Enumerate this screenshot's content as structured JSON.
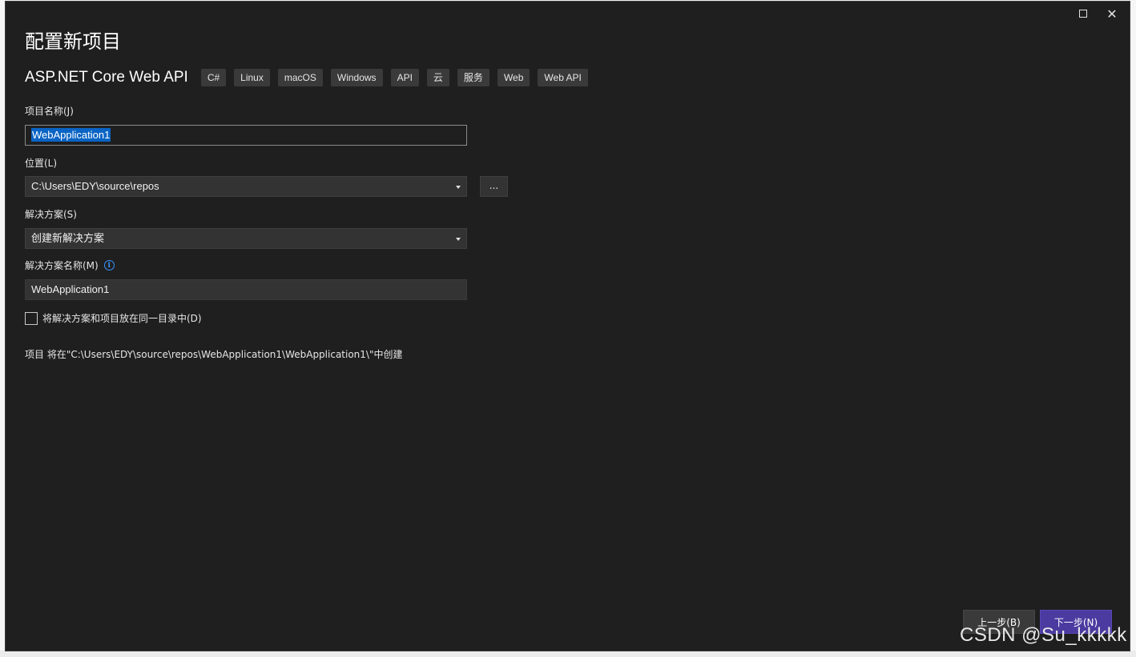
{
  "window": {
    "title": "配置新项目",
    "maximize_icon": "maximize-icon",
    "close_icon": "close-icon",
    "close_glyph": "✕"
  },
  "template": {
    "name": "ASP.NET Core Web API",
    "tags": [
      "C#",
      "Linux",
      "macOS",
      "Windows",
      "API",
      "云",
      "服务",
      "Web",
      "Web API"
    ]
  },
  "form": {
    "project_name_label": "项目名称(J)",
    "project_name_value": "WebApplication1",
    "location_label": "位置(L)",
    "location_value": "C:\\Users\\EDY\\source\\repos",
    "browse_label": "...",
    "solution_label": "解决方案(S)",
    "solution_value": "创建新解决方案",
    "solution_name_label": "解决方案名称(M)",
    "solution_name_value": "WebApplication1",
    "info_icon": "info-icon",
    "same_dir_label": "将解决方案和项目放在同一目录中(D)",
    "same_dir_checked": false,
    "path_note": "项目 将在\"C:\\Users\\EDY\\source\\repos\\WebApplication1\\WebApplication1\\\"中创建"
  },
  "footer": {
    "back_label": "上一步(B)",
    "next_label": "下一步(N)"
  },
  "watermark": "CSDN @Su_kkkkk",
  "colors": {
    "dialog_bg": "#1f1f1f",
    "accent_next": "#4b3aa0",
    "selection": "#0a64c4",
    "info": "#3794ff"
  }
}
